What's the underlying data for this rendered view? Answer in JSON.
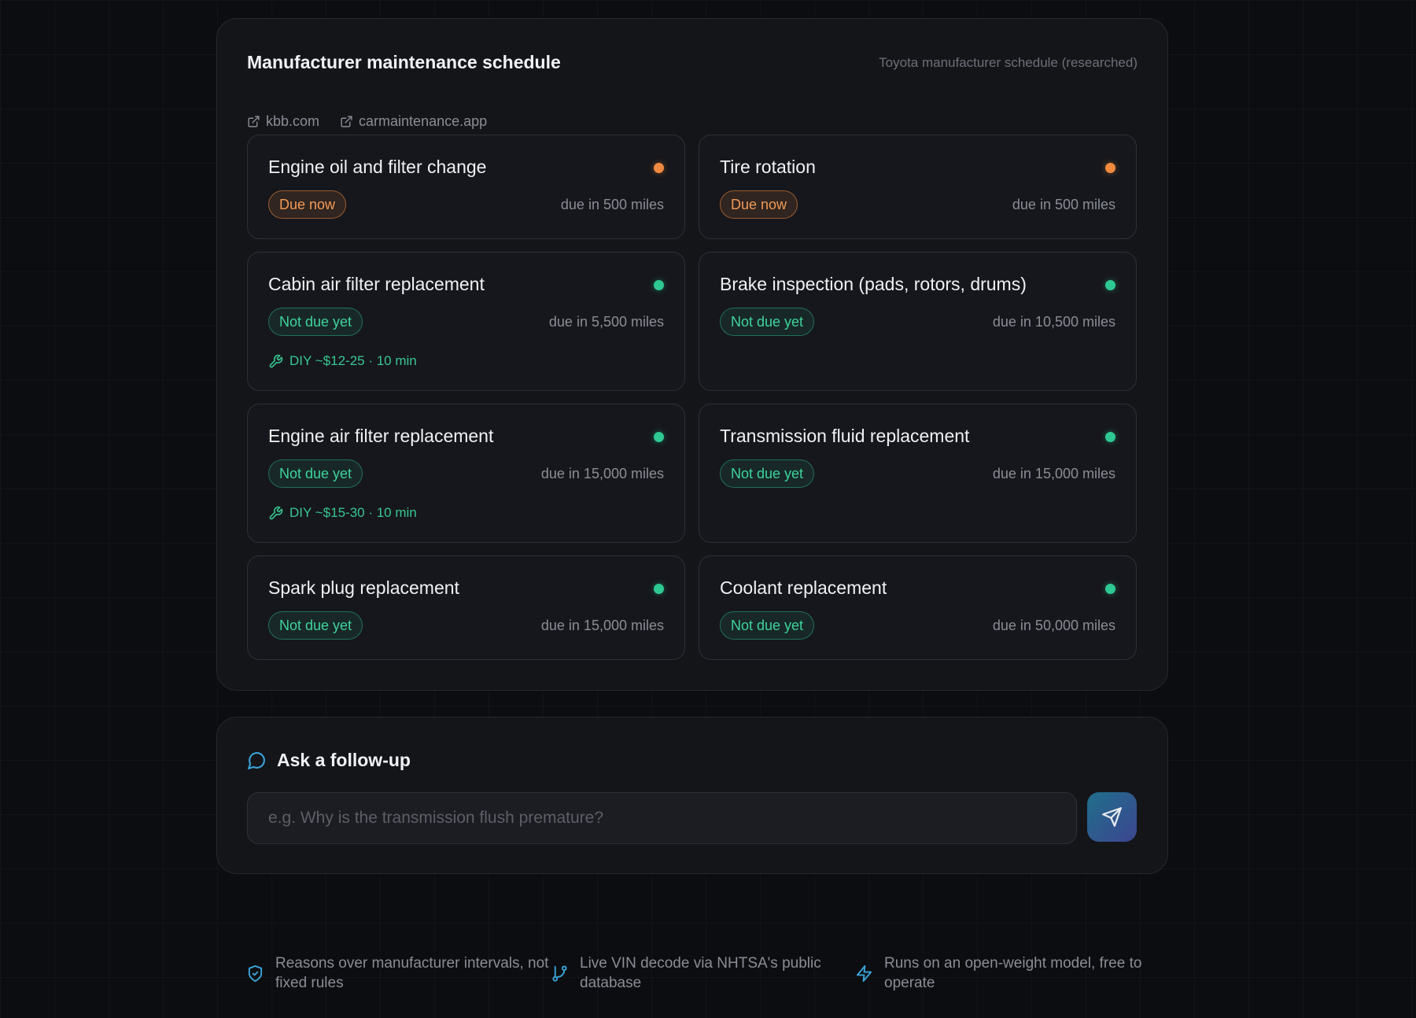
{
  "schedule": {
    "title": "Manufacturer maintenance schedule",
    "meta": "Toyota manufacturer schedule (researched)",
    "sources": [
      {
        "label": "kbb.com",
        "icon": "external-link-icon"
      },
      {
        "label": "carmaintenance.app",
        "icon": "external-link-icon"
      }
    ],
    "items": [
      {
        "title": "Engine oil and filter change",
        "status": "Due now",
        "due": "due in 500 miles"
      },
      {
        "title": "Tire rotation",
        "status": "Due now",
        "due": "due in 500 miles"
      },
      {
        "title": "Cabin air filter replacement",
        "status": "Not due yet",
        "due": "due in 5,500 miles",
        "diy": "DIY ~$12-25 · 10 min"
      },
      {
        "title": "Brake inspection (pads, rotors, drums)",
        "status": "Not due yet",
        "due": "due in 10,500 miles"
      },
      {
        "title": "Engine air filter replacement",
        "status": "Not due yet",
        "due": "due in 15,000 miles",
        "diy": "DIY ~$15-30 · 10 min"
      },
      {
        "title": "Transmission fluid replacement",
        "status": "Not due yet",
        "due": "due in 15,000 miles"
      },
      {
        "title": "Spark plug replacement",
        "status": "Not due yet",
        "due": "due in 15,000 miles"
      },
      {
        "title": "Coolant replacement",
        "status": "Not due yet",
        "due": "due in 50,000 miles"
      }
    ]
  },
  "followup": {
    "title": "Ask a follow-up",
    "icon": "chat-bubble-icon",
    "placeholder": "e.g. Why is the transmission flush premature?",
    "send_icon": "send-icon"
  },
  "features": [
    {
      "icon": "shield-check-icon",
      "text": "Reasons over manufacturer intervals, not fixed rules"
    },
    {
      "icon": "git-branch-icon",
      "text": "Live VIN decode via NHTSA's public database"
    },
    {
      "icon": "lightning-icon",
      "text": "Runs on an open-weight model, free to operate"
    }
  ],
  "colors": {
    "due": "#f08a3e",
    "ok": "#2ec992",
    "accent": "#3aa3d8"
  }
}
